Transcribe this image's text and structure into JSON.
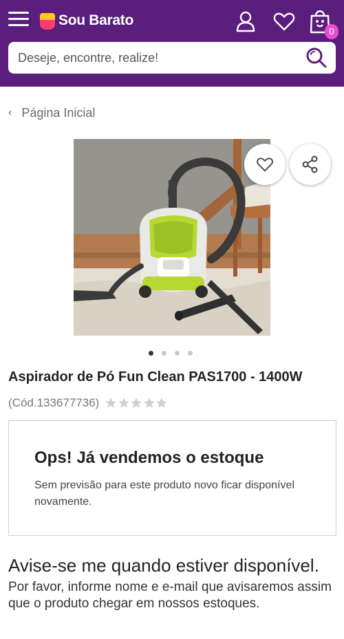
{
  "header": {
    "brand": "Sou Barato",
    "cart_count": "0",
    "icons": [
      "menu-icon",
      "user-icon",
      "heart-icon",
      "shopping-bag-icon"
    ],
    "search_placeholder": "Deseje, encontre, realize!"
  },
  "breadcrumb": {
    "label": "Página Inicial"
  },
  "product": {
    "title": "Aspirador de Pó Fun Clean PAS1700 - 1400W",
    "code": "(Cód.133677736)",
    "rating": 0,
    "rating_max": 5,
    "gallery": {
      "total_images": 4,
      "active_index": 0
    }
  },
  "out_of_stock": {
    "title": "Ops! Já vendemos o estoque",
    "text": "Sem previsão para este produto novo ficar disponível novamente."
  },
  "notify": {
    "title": "Avise-se me quando estiver disponível.",
    "text": "Por favor, informe nome e e-mail que avisaremos assim que o produto chegar em nossos estoques."
  },
  "colors": {
    "header_bg": "#5a1e7c",
    "badge": "#e84fd0",
    "logo_yellow": "#ffc629",
    "logo_pink": "#ff3c6e",
    "star_empty": "#d0d0d0"
  }
}
